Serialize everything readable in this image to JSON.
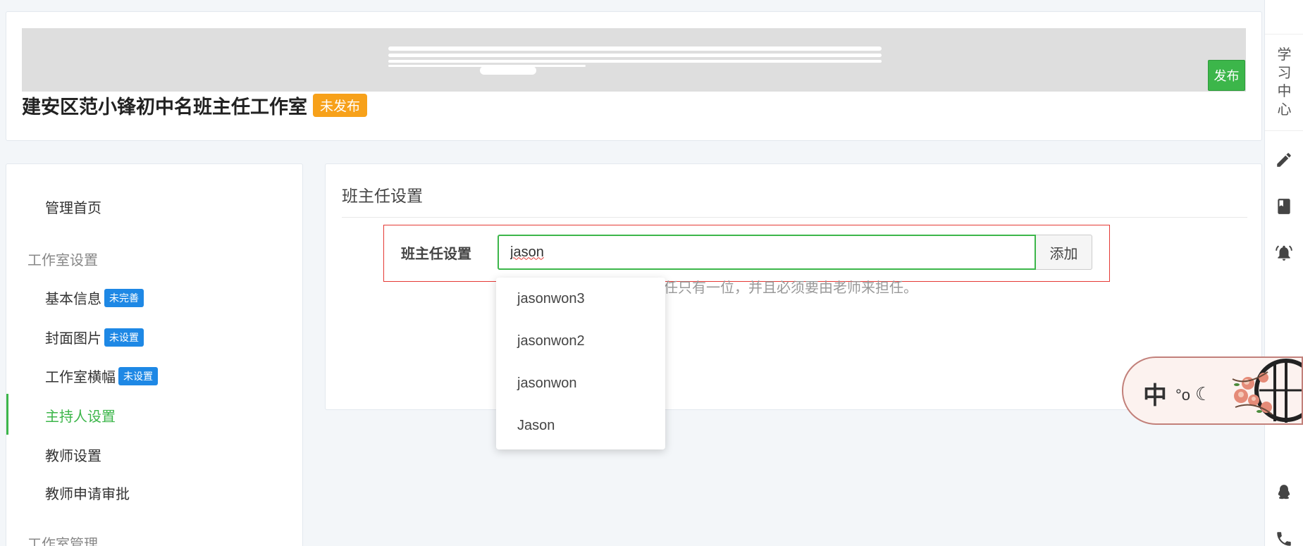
{
  "header": {
    "publish_label": "发布",
    "studio_name": "建安区范小锋初中名班主任工作室",
    "status_badge": "未发布"
  },
  "sidebar": {
    "home": "管理首页",
    "group_settings": "工作室设置",
    "items": [
      {
        "label": "基本信息",
        "tag": "未完善"
      },
      {
        "label": "封面图片",
        "tag": "未设置"
      },
      {
        "label": "工作室横幅",
        "tag": "未设置"
      },
      {
        "label": "主持人设置",
        "tag": ""
      },
      {
        "label": "教师设置",
        "tag": ""
      },
      {
        "label": "教师申请审批",
        "tag": ""
      }
    ],
    "group_manage": "工作室管理"
  },
  "main": {
    "title": "班主任设置",
    "form_label": "班主任设置",
    "input_value": "jason",
    "add_button": "添加",
    "help_text": "逐，班主任只有一位，并且必须要由老师来担任。"
  },
  "dropdown": {
    "options": [
      "jasonwon3",
      "jasonwon2",
      "jasonwon",
      "Jason"
    ]
  },
  "right_rail": {
    "learning_center": [
      "学",
      "习",
      "中",
      "心"
    ]
  },
  "ime": {
    "lang": "中",
    "punct": "°o",
    "mode": "☾"
  },
  "colors": {
    "accent_green": "#3cb64a",
    "badge_orange": "#f7a11a",
    "tag_blue": "#1e88e5",
    "highlight_red": "#e53935"
  }
}
